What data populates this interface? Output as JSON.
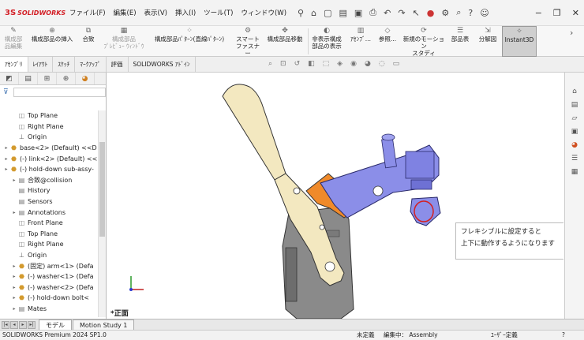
{
  "app": {
    "logo_mark": "3S",
    "logo_text": "SOLIDWORKS",
    "menus": [
      "ファイル(F)",
      "編集(E)",
      "表示(V)",
      "挿入(I)",
      "ツール(T)",
      "ウィンドウ(W)"
    ],
    "toolbar_icons": [
      "pin-icon",
      "home-icon",
      "new-file-icon",
      "open-icon",
      "save-icon",
      "print-icon",
      "undo-icon",
      "redo-icon",
      "select-icon",
      "traffic-light-icon",
      "options-icon",
      "search-icon",
      "help-icon",
      "user-icon"
    ],
    "window_controls": [
      "minimize",
      "restore",
      "close"
    ]
  },
  "ribbon": {
    "buttons": [
      {
        "label1": "構成部",
        "label2": "品編集",
        "dim": true
      },
      {
        "label1": "構成部品の挿入",
        "label2": "",
        "dim": false
      },
      {
        "label1": "合致",
        "label2": "",
        "dim": false
      },
      {
        "label1": "構成部品",
        "label2": "ﾌﾟﾚﾋﾞｭｰ ｳｨﾝﾄﾞｳ",
        "dim": true
      },
      {
        "label1": "構成部品ﾊﾟﾀｰﾝ(直線ﾊﾟﾀｰﾝ)",
        "label2": "",
        "dim": false
      },
      {
        "label1": "スマート",
        "label2": "ファスナー",
        "dim": false
      },
      {
        "label1": "構成部品移動",
        "label2": "",
        "dim": false
      },
      {
        "label1": "非表示構成",
        "label2": "部品の表示",
        "dim": false
      },
      {
        "label1": "ｱｾﾝﾌﾞ...",
        "label2": "",
        "dim": false
      },
      {
        "label1": "参照...",
        "label2": "",
        "dim": false
      },
      {
        "label1": "新規のモーション",
        "label2": "スタディ",
        "dim": false
      },
      {
        "label1": "部品表",
        "label2": "",
        "dim": false
      },
      {
        "label1": "分解図",
        "label2": "",
        "dim": false
      },
      {
        "label1": "Instant3D",
        "label2": "",
        "dim": false,
        "active": true
      }
    ]
  },
  "command_tabs": [
    "ｱｾﾝﾌﾞﾘ",
    "ﾚｲｱｳﾄ",
    "ｽｹｯﾁ",
    "ﾏｰｸｱｯﾌﾟ",
    "評価",
    "SOLIDWORKS ｱﾄﾞｲﾝ"
  ],
  "feature_tree": {
    "rows": [
      {
        "indent": 1,
        "icon": "plane",
        "label": "Top Plane"
      },
      {
        "indent": 1,
        "icon": "plane",
        "label": "Right Plane"
      },
      {
        "indent": 1,
        "icon": "origin",
        "label": "Origin"
      },
      {
        "indent": 0,
        "icon": "part",
        "label": "base<2> (Default) <<D",
        "expand": true
      },
      {
        "indent": 0,
        "icon": "part",
        "label": "(-) link<2> (Default) <<",
        "expand": true
      },
      {
        "indent": 0,
        "icon": "part",
        "label": "(-) hold-down sub-assy-",
        "expand": true
      },
      {
        "indent": 1,
        "icon": "feat",
        "label": "合致@collision",
        "expand": true
      },
      {
        "indent": 1,
        "icon": "feat",
        "label": "History"
      },
      {
        "indent": 1,
        "icon": "feat",
        "label": "Sensors"
      },
      {
        "indent": 1,
        "icon": "feat",
        "label": "Annotations",
        "expand": true
      },
      {
        "indent": 1,
        "icon": "plane",
        "label": "Front Plane"
      },
      {
        "indent": 1,
        "icon": "plane",
        "label": "Top Plane"
      },
      {
        "indent": 1,
        "icon": "plane",
        "label": "Right Plane"
      },
      {
        "indent": 1,
        "icon": "origin",
        "label": "Origin"
      },
      {
        "indent": 1,
        "icon": "part",
        "label": "(固定) arm<1> (Defa",
        "expand": true
      },
      {
        "indent": 1,
        "icon": "part",
        "label": "(-) washer<1> (Defa",
        "expand": true
      },
      {
        "indent": 1,
        "icon": "part",
        "label": "(-) washer<2> (Defa",
        "expand": true
      },
      {
        "indent": 1,
        "icon": "part",
        "label": "(-) hold-down bolt<",
        "expand": true
      },
      {
        "indent": 1,
        "icon": "feat",
        "label": "Mates",
        "expand": true
      }
    ]
  },
  "viewport": {
    "view_label": "*正面",
    "callout_line1": "フレキシブルに設定すると",
    "callout_line2": "上下に動作するようになります"
  },
  "bottom_tabs": [
    "モデル",
    "Motion Study 1"
  ],
  "status": {
    "version": "SOLIDWORKS Premium 2024 SP1.0",
    "definition": "未定義",
    "editing": "編集中： Assembly",
    "user_defined": "ﾕｰｻﾞｰ定義"
  },
  "colors": {
    "accent_red": "#d31f26",
    "part_yellow": "#f3e8c0",
    "part_gray": "#8a8a8a",
    "part_blue": "#8b8ee8",
    "part_orange": "#f08a2a"
  }
}
